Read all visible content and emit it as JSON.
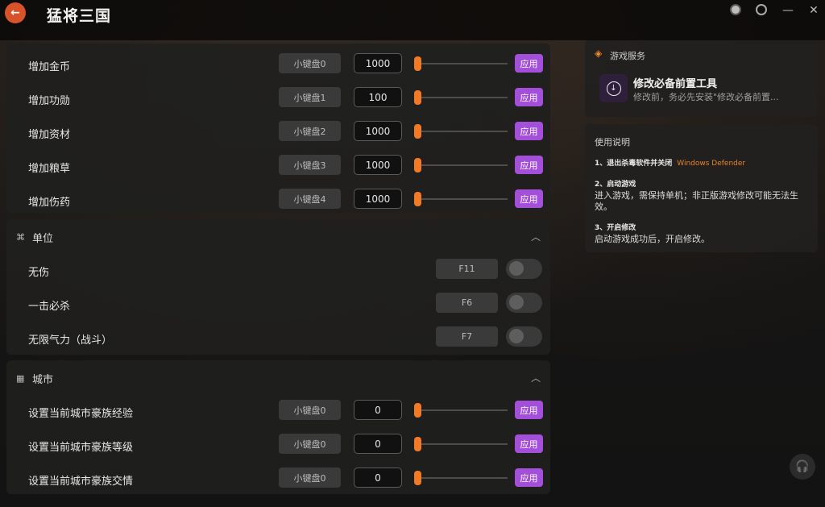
{
  "app": {
    "title": "猛将三国"
  },
  "resources": {
    "rows": [
      {
        "label": "增加金币",
        "hotkey": "小键盘0",
        "value": "1000",
        "apply": "应用"
      },
      {
        "label": "增加功勋",
        "hotkey": "小键盘1",
        "value": "100",
        "apply": "应用"
      },
      {
        "label": "增加资材",
        "hotkey": "小键盘2",
        "value": "1000",
        "apply": "应用"
      },
      {
        "label": "增加粮草",
        "hotkey": "小键盘3",
        "value": "1000",
        "apply": "应用"
      },
      {
        "label": "增加伤药",
        "hotkey": "小键盘4",
        "value": "1000",
        "apply": "应用"
      }
    ]
  },
  "unit": {
    "title": "单位",
    "rows": [
      {
        "label": "无伤",
        "hotkey": "F11",
        "enabled": false
      },
      {
        "label": "一击必杀",
        "hotkey": "F6",
        "enabled": false
      },
      {
        "label": "无限气力（战斗）",
        "hotkey": "F7",
        "enabled": false
      }
    ]
  },
  "city": {
    "title": "城市",
    "rows": [
      {
        "label": "设置当前城市豪族经验",
        "hotkey": "小键盘0",
        "value": "0",
        "apply": "应用"
      },
      {
        "label": "设置当前城市豪族等级",
        "hotkey": "小键盘0",
        "value": "0",
        "apply": "应用"
      },
      {
        "label": "设置当前城市豪族交情",
        "hotkey": "小键盘0",
        "value": "0",
        "apply": "应用"
      }
    ]
  },
  "service": {
    "title": "游戏服务",
    "tool_name": "修改必备前置工具",
    "tool_desc": "修改前，务必先安装\"修改必备前置..."
  },
  "instructions": {
    "title": "使用说明",
    "step1_title": "1、退出杀毒软件并关闭",
    "step1_highlight": "Windows Defender",
    "step2_title": "2、启动游戏",
    "step2_body": "进入游戏，需保持单机；非正版游戏修改可能无法生效。",
    "step3_title": "3、开启修改",
    "step3_body": "启动游戏成功后，开启修改。"
  },
  "colors": {
    "accent": "#a34fd9",
    "slider": "#f07a25",
    "back": "#d9532a"
  }
}
